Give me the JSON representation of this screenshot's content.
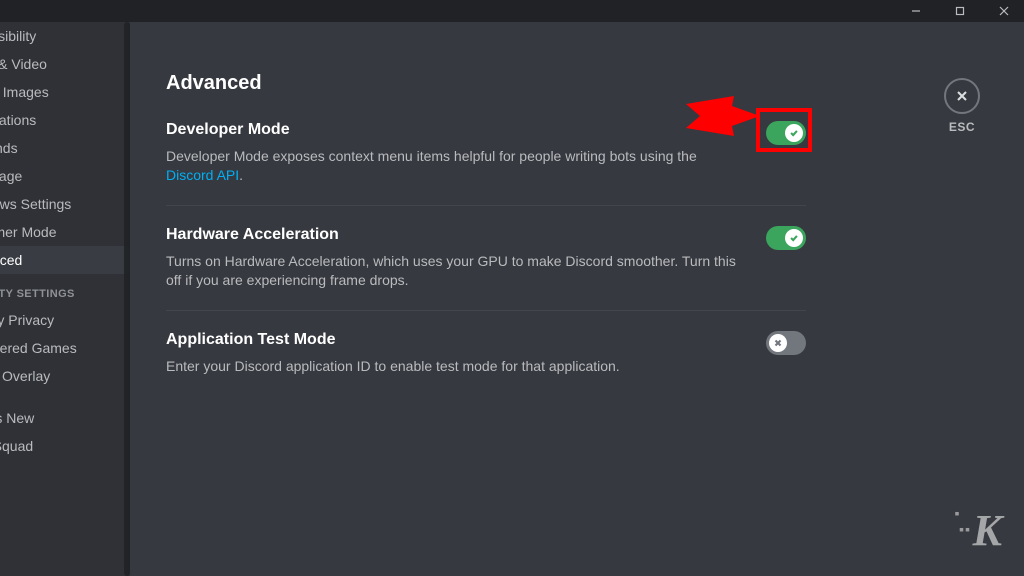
{
  "titlebar": {
    "minimize": "minimize",
    "maximize": "maximize",
    "close": "close"
  },
  "sidebar": {
    "items_top": [
      "Accessibility",
      "Voice & Video",
      "Text & Images",
      "Notifications",
      "Keybinds",
      "Language",
      "Windows Settings",
      "Streamer Mode",
      "Advanced"
    ],
    "header_activity": "ACTIVITY SETTINGS",
    "items_activity": [
      "Activity Privacy",
      "Registered Games",
      "Game Overlay"
    ],
    "items_bottom": [
      "What's New",
      "HypeSquad"
    ]
  },
  "page": {
    "title": "Advanced",
    "close_label": "ESC"
  },
  "settings": {
    "dev": {
      "title": "Developer Mode",
      "desc_before": "Developer Mode exposes context menu items helpful for people writing bots using the ",
      "desc_link": "Discord API",
      "desc_after": "."
    },
    "hw": {
      "title": "Hardware Acceleration",
      "desc": "Turns on Hardware Acceleration, which uses your GPU to make Discord smoother. Turn this off if you are experiencing frame drops."
    },
    "test": {
      "title": "Application Test Mode",
      "desc": "Enter your Discord application ID to enable test mode for that application."
    }
  },
  "watermark": "K"
}
